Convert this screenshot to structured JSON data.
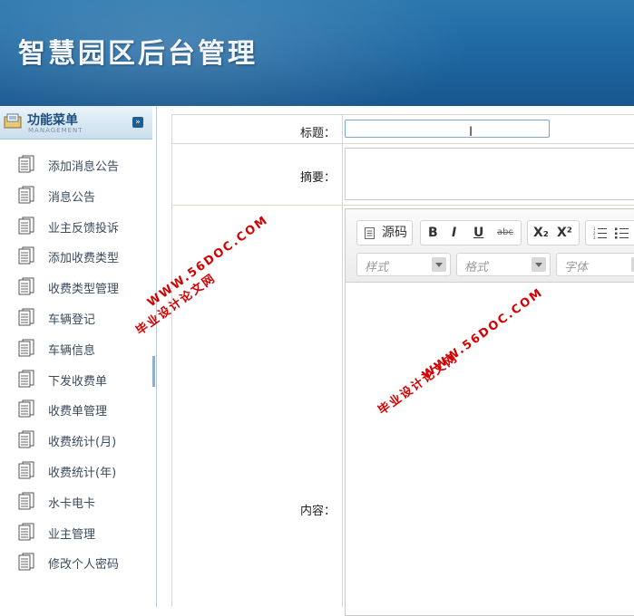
{
  "header": {
    "title": "智慧园区后台管理"
  },
  "sidebar": {
    "title": "功能菜单",
    "subtitle": "MANAGEMENT",
    "items": [
      {
        "label": "添加消息公告"
      },
      {
        "label": "消息公告"
      },
      {
        "label": "业主反馈投诉"
      },
      {
        "label": "添加收费类型"
      },
      {
        "label": "收费类型管理"
      },
      {
        "label": "车辆登记"
      },
      {
        "label": "车辆信息"
      },
      {
        "label": "下发收费单"
      },
      {
        "label": "收费单管理"
      },
      {
        "label": "收费统计(月)"
      },
      {
        "label": "收费统计(年)"
      },
      {
        "label": "水卡电卡"
      },
      {
        "label": "业主管理"
      },
      {
        "label": "修改个人密码"
      }
    ]
  },
  "form": {
    "title_label": "标题：",
    "summary_label": "摘要：",
    "content_label": "内容：",
    "title_value": "",
    "summary_value": ""
  },
  "editor": {
    "source_label": "源码",
    "bold": "B",
    "italic": "I",
    "underline": "U",
    "strike": "abc",
    "subscript": "X₂",
    "superscript": "X²",
    "styles_placeholder": "样式",
    "format_placeholder": "格式",
    "font_placeholder": "字体"
  },
  "watermarks": {
    "url": "WWW.56DOC.COM",
    "site": "毕业设计论文网"
  }
}
